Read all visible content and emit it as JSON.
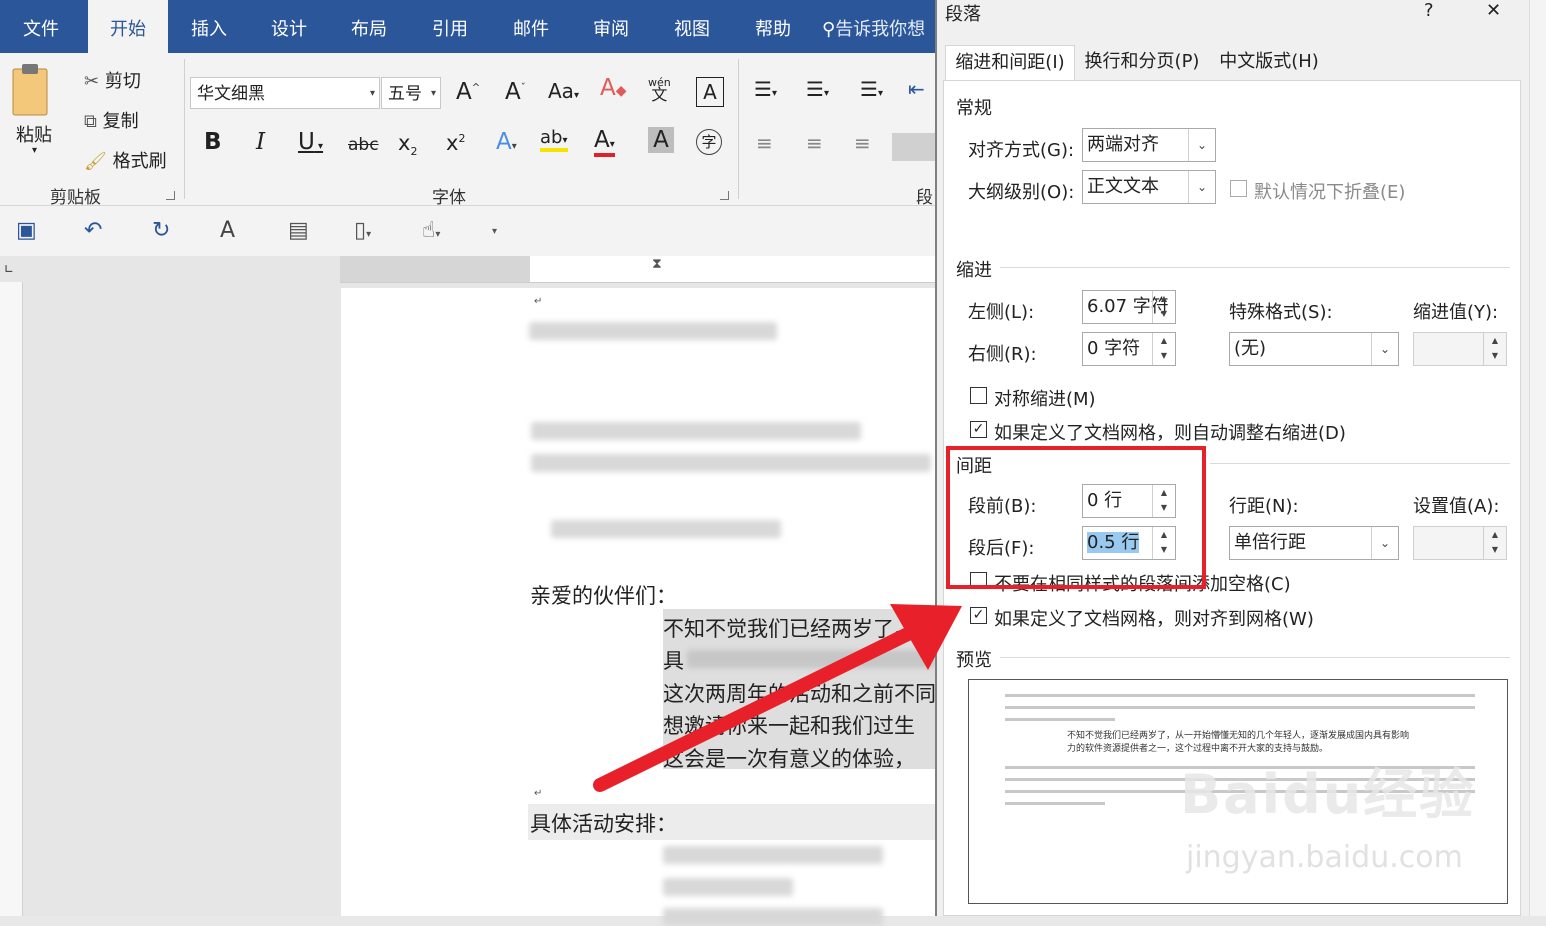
{
  "ribbon": {
    "tabs": [
      "文件",
      "开始",
      "插入",
      "设计",
      "布局",
      "引用",
      "邮件",
      "审阅",
      "视图",
      "帮助"
    ],
    "tell_me": "告诉我你想",
    "clipboard": {
      "paste": "粘贴",
      "cut": "剪切",
      "copy": "复制",
      "format_painter": "格式刷",
      "group": "剪贴板"
    },
    "font": {
      "name": "华文细黑",
      "size": "五号",
      "group": "字体",
      "bold": "B",
      "italic": "I",
      "underline": "U",
      "strike": "abc",
      "aa": "Aa",
      "pinyin": "wén",
      "pinyin_char": "文",
      "box_char": "A",
      "encircle": "字"
    },
    "paragraph_group": "段"
  },
  "document": {
    "greeting": "亲爱的伙伴们：",
    "line1": "不知不觉我们已经两岁了。",
    "line2": "具",
    "line3": "这次两周年的活动和之前不同",
    "line4": "想邀请你来一起和我们过生",
    "line5": "这会是一次有意义的体验，",
    "schedule": "具体活动安排："
  },
  "dialog": {
    "title": "段落",
    "help": "?",
    "close": "✕",
    "tabs": [
      "缩进和间距(I)",
      "换行和分页(P)",
      "中文版式(H)"
    ],
    "general": {
      "heading": "常规",
      "alignment_label": "对齐方式(G):",
      "alignment_value": "两端对齐",
      "outline_label": "大纲级别(O):",
      "outline_value": "正文文本",
      "collapse_label": "默认情况下折叠(E)"
    },
    "indent": {
      "heading": "缩进",
      "left_label": "左侧(L):",
      "left_value": "6.07 字符",
      "right_label": "右侧(R):",
      "right_value": "0 字符",
      "special_label": "特殊格式(S):",
      "special_value": "(无)",
      "by_label": "缩进值(Y):",
      "mirror_label": "对称缩进(M)",
      "auto_adjust_label": "如果定义了文档网格，则自动调整右缩进(D)"
    },
    "spacing": {
      "heading": "间距",
      "before_label": "段前(B):",
      "before_value": "0 行",
      "after_label": "段后(F):",
      "after_value": "0.5 行",
      "line_label": "行距(N):",
      "line_value": "单倍行距",
      "at_label": "设置值(A):",
      "no_space_label": "不要在相同样式的段落间添加空格(C)",
      "snap_grid_label": "如果定义了文档网格，则对齐到网格(W)"
    },
    "preview": {
      "heading": "预览",
      "sample1": "不知不觉我们已经两岁了，从一开始懵懂无知的几个年轻人，逐渐发展成国内具有影响",
      "sample2": "力的软件资源提供者之一，这个过程中离不开大家的支持与鼓励。"
    }
  },
  "watermark": {
    "brand": "Baidu经验",
    "url": "jingyan.baidu.com"
  },
  "colors": {
    "ribbon_blue": "#2b579a",
    "highlight_red": "#e8202a",
    "selection": "#99c9ef"
  }
}
